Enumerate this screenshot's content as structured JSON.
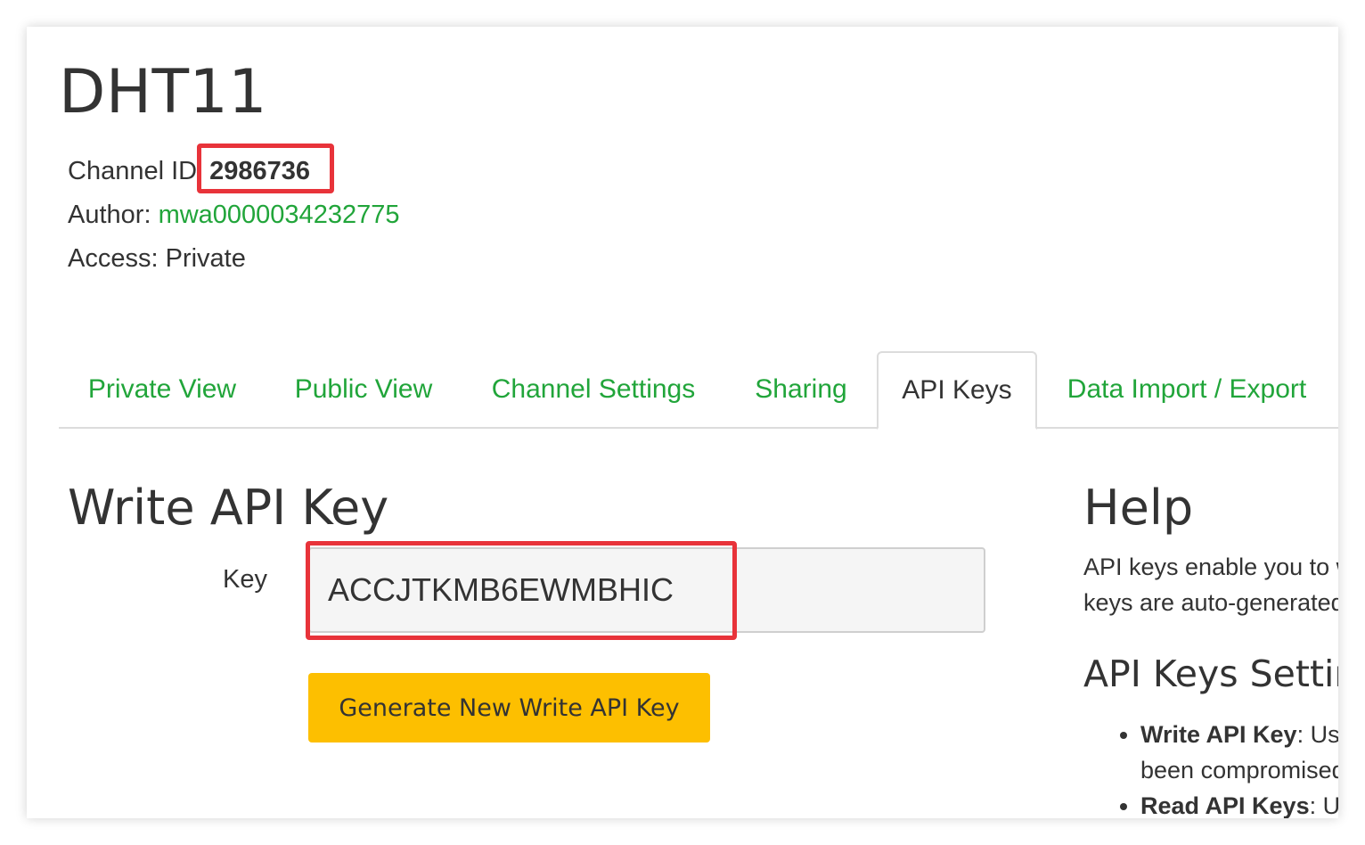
{
  "channel": {
    "name": "DHT11",
    "id_label": "Channel ID",
    "id_value": "2986736",
    "author_label": "Author:",
    "author_value": "mwa0000034232775",
    "access_label": "Access:",
    "access_value": "Private"
  },
  "tabs": [
    {
      "label": "Private View",
      "active": false
    },
    {
      "label": "Public View",
      "active": false
    },
    {
      "label": "Channel Settings",
      "active": false
    },
    {
      "label": "Sharing",
      "active": false
    },
    {
      "label": "API Keys",
      "active": true
    },
    {
      "label": "Data Import / Export",
      "active": false
    }
  ],
  "write_key": {
    "title": "Write API Key",
    "key_label": "Key",
    "key_value": "ACCJTKMB6EWMBHIC",
    "generate_button": "Generate New Write API Key"
  },
  "help": {
    "title": "Help",
    "line1": "API keys enable you to w",
    "line2": "keys are auto-generated",
    "settings_title": "API Keys Settin",
    "items": [
      {
        "term": "Write API Key",
        "text": ": Use",
        "continuation": "been compromised"
      },
      {
        "term": "Read API Keys",
        "text": ": Use"
      }
    ]
  },
  "colors": {
    "link_green": "#21a53a",
    "highlight_red": "#e8333a",
    "button_yellow": "#fdbf00"
  }
}
